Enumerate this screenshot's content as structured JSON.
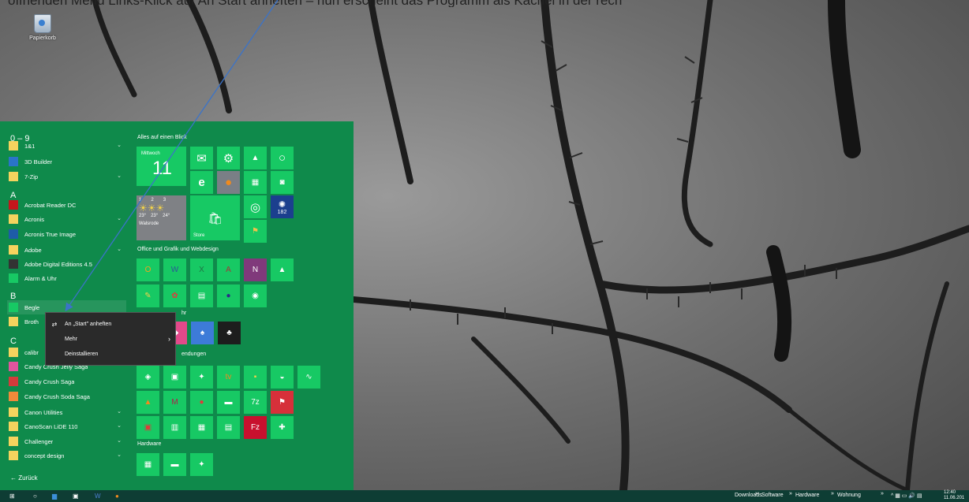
{
  "caption": "öffnenden Menü Links-Klick auf An Start anheften – nun erscheint das Programm als Kachel in der rech",
  "desktop": {
    "recycle_bin_label": "Papierkorb"
  },
  "start_menu": {
    "app_list": {
      "headers": [
        "0 – 9",
        "A",
        "B",
        "C"
      ],
      "items": [
        {
          "label": "1&1",
          "icon": "folder-icon",
          "color": "#f4d35e",
          "expand": true
        },
        {
          "label": "3D Builder",
          "icon": "3d-builder-icon",
          "color": "#2a74c8",
          "expand": false
        },
        {
          "label": "7-Zip",
          "icon": "folder-icon",
          "color": "#f4d35e",
          "expand": true
        },
        {
          "label": "Acrobat Reader DC",
          "icon": "acrobat-icon",
          "color": "#c4161c",
          "expand": false
        },
        {
          "label": "Acronis",
          "icon": "folder-icon",
          "color": "#f4d35e",
          "expand": true
        },
        {
          "label": "Acronis True Image",
          "icon": "acronis-icon",
          "color": "#1e5ca8",
          "expand": false
        },
        {
          "label": "Adobe",
          "icon": "folder-icon",
          "color": "#f4d35e",
          "expand": true
        },
        {
          "label": "Adobe Digital Editions 4.5",
          "icon": "adobe-de-icon",
          "color": "#333333",
          "expand": false
        },
        {
          "label": "Alarm & Uhr",
          "icon": "alarm-icon",
          "color": "#17c964",
          "expand": false
        },
        {
          "label": "Begle",
          "icon": "begleiter-icon",
          "color": "#17c964",
          "expand": false
        },
        {
          "label": "Broth",
          "icon": "folder-icon",
          "color": "#f4d35e",
          "expand": false
        },
        {
          "label": "calibr",
          "icon": "folder-icon",
          "color": "#f4d35e",
          "expand": false
        },
        {
          "label": "Candy Crush Jelly Saga",
          "icon": "candy-jelly-icon",
          "color": "#e0559e",
          "expand": false
        },
        {
          "label": "Candy Crush Saga",
          "icon": "candy-crush-icon",
          "color": "#d33b3b",
          "expand": false
        },
        {
          "label": "Candy Crush Soda Saga",
          "icon": "candy-soda-icon",
          "color": "#f08a3a",
          "expand": false
        },
        {
          "label": "Canon Utilities",
          "icon": "folder-icon",
          "color": "#f4d35e",
          "expand": true
        },
        {
          "label": "CanoScan LiDE 110",
          "icon": "folder-icon",
          "color": "#f4d35e",
          "expand": true
        },
        {
          "label": "Challenger",
          "icon": "folder-icon",
          "color": "#f4d35e",
          "expand": true
        },
        {
          "label": "concept design",
          "icon": "folder-icon",
          "color": "#f4d35e",
          "expand": true
        }
      ],
      "back_label": "← Zurück"
    },
    "tiles": {
      "groups": [
        "Alles auf einen Blick",
        "Office und Grafik und Webdesign",
        "hr",
        "endungen",
        "Hardware"
      ],
      "calendar_day": "Mittwoch",
      "calendar_date": "11",
      "weather": {
        "days": [
          "1",
          "2",
          "3"
        ],
        "temps": [
          "23°",
          "23°",
          "24°"
        ],
        "city": "Walsrode"
      },
      "store_label": "Store",
      "badge_value": "182"
    }
  },
  "context_menu": {
    "items": [
      {
        "label": "An „Start\" anheften",
        "glyph": "⇄"
      },
      {
        "label": "Mehr",
        "glyph": ""
      },
      {
        "label": "Deinstallieren",
        "glyph": ""
      }
    ],
    "more_arrow": "›"
  },
  "taskbar": {
    "toolbars": [
      "Downloads",
      "Software",
      "Hardware",
      "Wohnung"
    ],
    "chevron": "»",
    "time": "12:40",
    "date": "11.06.201"
  },
  "colors": {
    "start_bg": "#0f8a4b",
    "tile": "#17c964",
    "taskbar": "#0e3d34",
    "annotation_arrow": "#3b73c8"
  }
}
